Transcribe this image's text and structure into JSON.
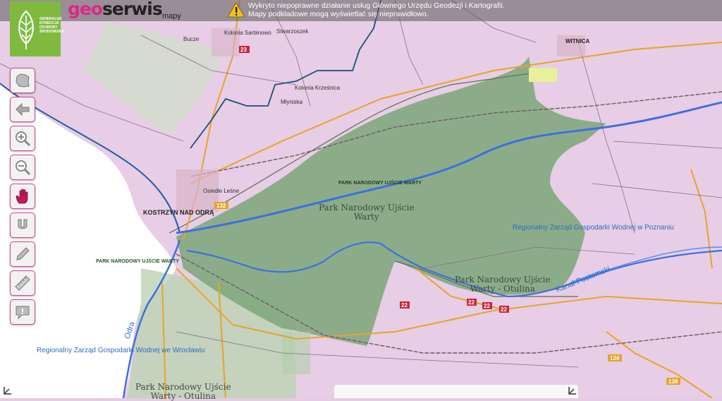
{
  "logo": {
    "org_text": "GENERALNA DYREKCJA OCHRONY ŚRODOWISKA",
    "brand_color": "#7fba3f"
  },
  "brand": {
    "name_geo": "geo",
    "name_serwis": "serwis",
    "subtitle": "mapy",
    "accent": "#d92b85"
  },
  "warning": {
    "icon": "warning-triangle-icon",
    "line1": "Wykryto niepoprawne działanie usług Głównego Urzędu Geodezji i Kartografii.",
    "line2": "Mapy podkładowe mogą wyświetlać się nieprawidłowo."
  },
  "tools": [
    {
      "name": "full-extent",
      "icon": "poland-map-icon"
    },
    {
      "name": "previous-view",
      "icon": "arrow-left-icon"
    },
    {
      "name": "zoom-in",
      "icon": "zoom-in-icon"
    },
    {
      "name": "zoom-out",
      "icon": "zoom-out-icon"
    },
    {
      "name": "pan",
      "icon": "hand-icon"
    },
    {
      "name": "identify",
      "icon": "magnet-icon"
    },
    {
      "name": "draw",
      "icon": "pencil-icon"
    },
    {
      "name": "measure",
      "icon": "ruler-icon"
    },
    {
      "name": "message",
      "icon": "comment-icon"
    }
  ],
  "map_labels": {
    "park_main_1": "Park Narodowy Ujście",
    "park_main_2": "Warty",
    "park_upper": "PARK NARODOWY UJŚCIE WARTY",
    "park_left": "PARK NARODOWY UJŚCIE WARTY",
    "park_right_1": "Park Narodowy Ujście",
    "park_right_2": "Warty - Otulina",
    "park_bottom_1": "Park Narodowy Ujście",
    "park_bottom_2": "Warty - Otulina",
    "rzgw_poznan": "Regionalny Zarząd Gospodarki Wodnej w Poznaniu",
    "rzgw_wroclaw": "Regionalny Zarząd Gospodarki Wodnej we Wrocławiu",
    "river_odra": "Odra",
    "canal": "Kanał Postomski",
    "city": "KOSTRZYN NAD ODRĄ",
    "town_witnica": "WITNICA",
    "town_sarbinowo": "Kolonia Sarbinowo",
    "town_stwarzoszek": "Stwarzoszek",
    "town_bucze": "Bucze",
    "town_kolonia_krzesnica": "Kolonia Krześnica",
    "town_mlyniska": "Młyniska",
    "town_osiedle": "Osiedle Leśne",
    "road_23": "23",
    "road_132": "132",
    "road_22": "22",
    "road_134": "134",
    "road_138": "138"
  },
  "colors": {
    "land_pink": "#e6cbe4",
    "park_green": "#7fa77c",
    "water_blue": "#3f6fe0",
    "road_orange": "#e7a42a",
    "road_red_badge": "#c8283c"
  }
}
